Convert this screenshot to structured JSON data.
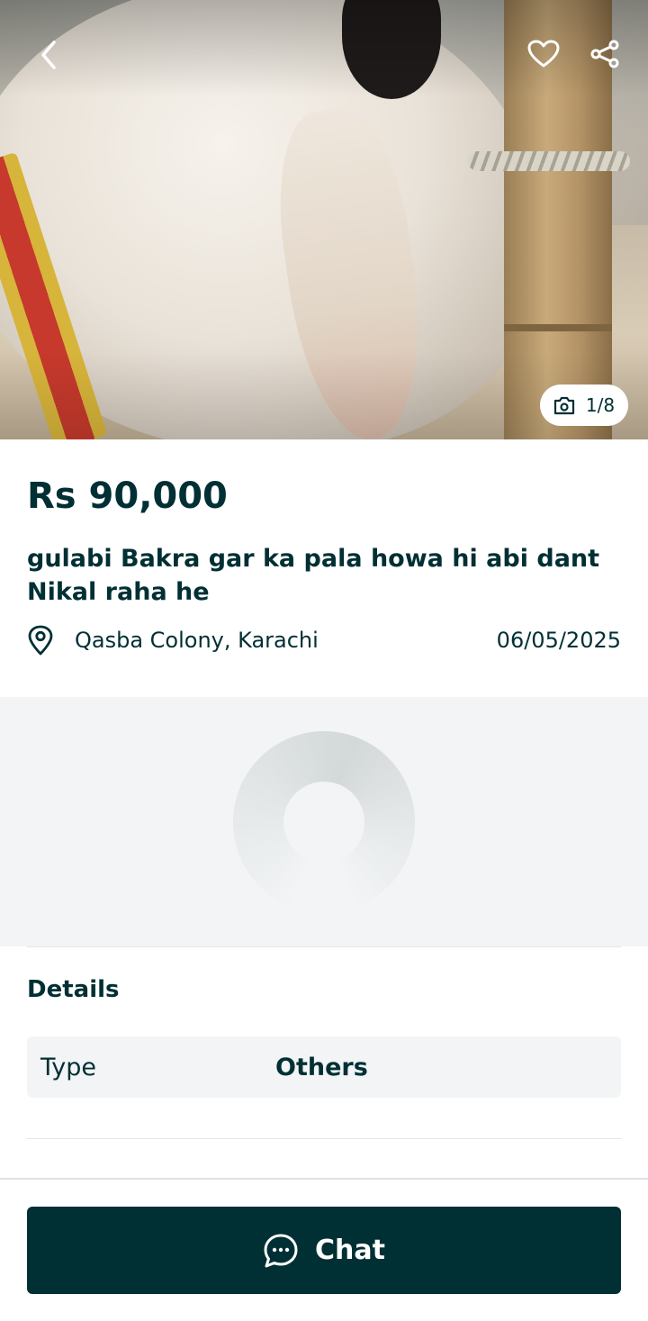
{
  "colors": {
    "primary": "#002f34",
    "surface": "#f2f4f5",
    "white": "#ffffff"
  },
  "gallery": {
    "icons": {
      "back": "chevron-left-icon",
      "favorite": "heart-icon",
      "share": "share-icon",
      "camera": "camera-icon"
    },
    "counter_text": "1/8"
  },
  "listing": {
    "price": "Rs 90,000",
    "title": "gulabi Bakra gar ka pala howa hi abi dant Nikal raha he",
    "location": "Qasba Colony, Karachi",
    "date": "06/05/2025"
  },
  "details": {
    "heading": "Details",
    "rows": [
      {
        "key": "Type",
        "value": "Others"
      }
    ]
  },
  "actions": {
    "chat_label": "Chat"
  }
}
